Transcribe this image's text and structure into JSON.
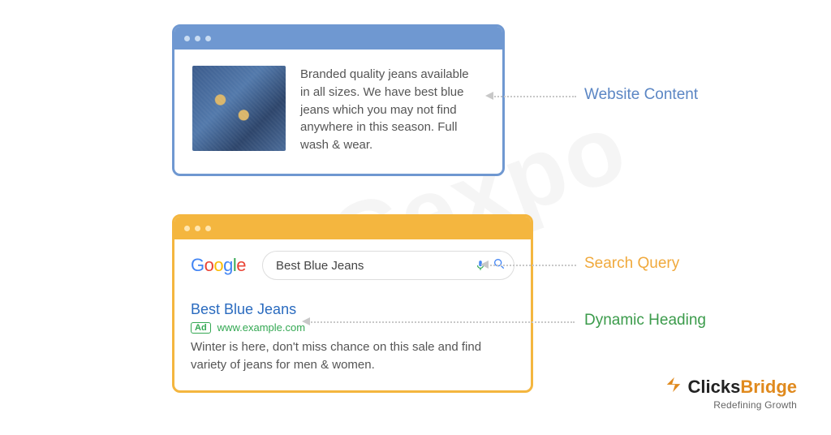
{
  "watermark": "PPCexpo",
  "labels": {
    "website_content": "Website Content",
    "search_query": "Search Query",
    "dynamic_heading": "Dynamic Heading"
  },
  "website_window": {
    "text": "Branded quality jeans available in all sizes. We have best blue jeans which you may not find anywhere in this season. Full wash & wear."
  },
  "search_window": {
    "logo_letters": [
      "G",
      "o",
      "o",
      "g",
      "l",
      "e"
    ],
    "query": "Best Blue Jeans",
    "ad": {
      "title": "Best Blue Jeans",
      "badge": "Ad",
      "url": "www.example.com",
      "description": "Winter is here, don't miss chance on this sale and find variety of jeans for men & women."
    }
  },
  "brand": {
    "name_plain": "Clicks",
    "name_accent": "Bridge",
    "tagline": "Redefining Growth"
  }
}
